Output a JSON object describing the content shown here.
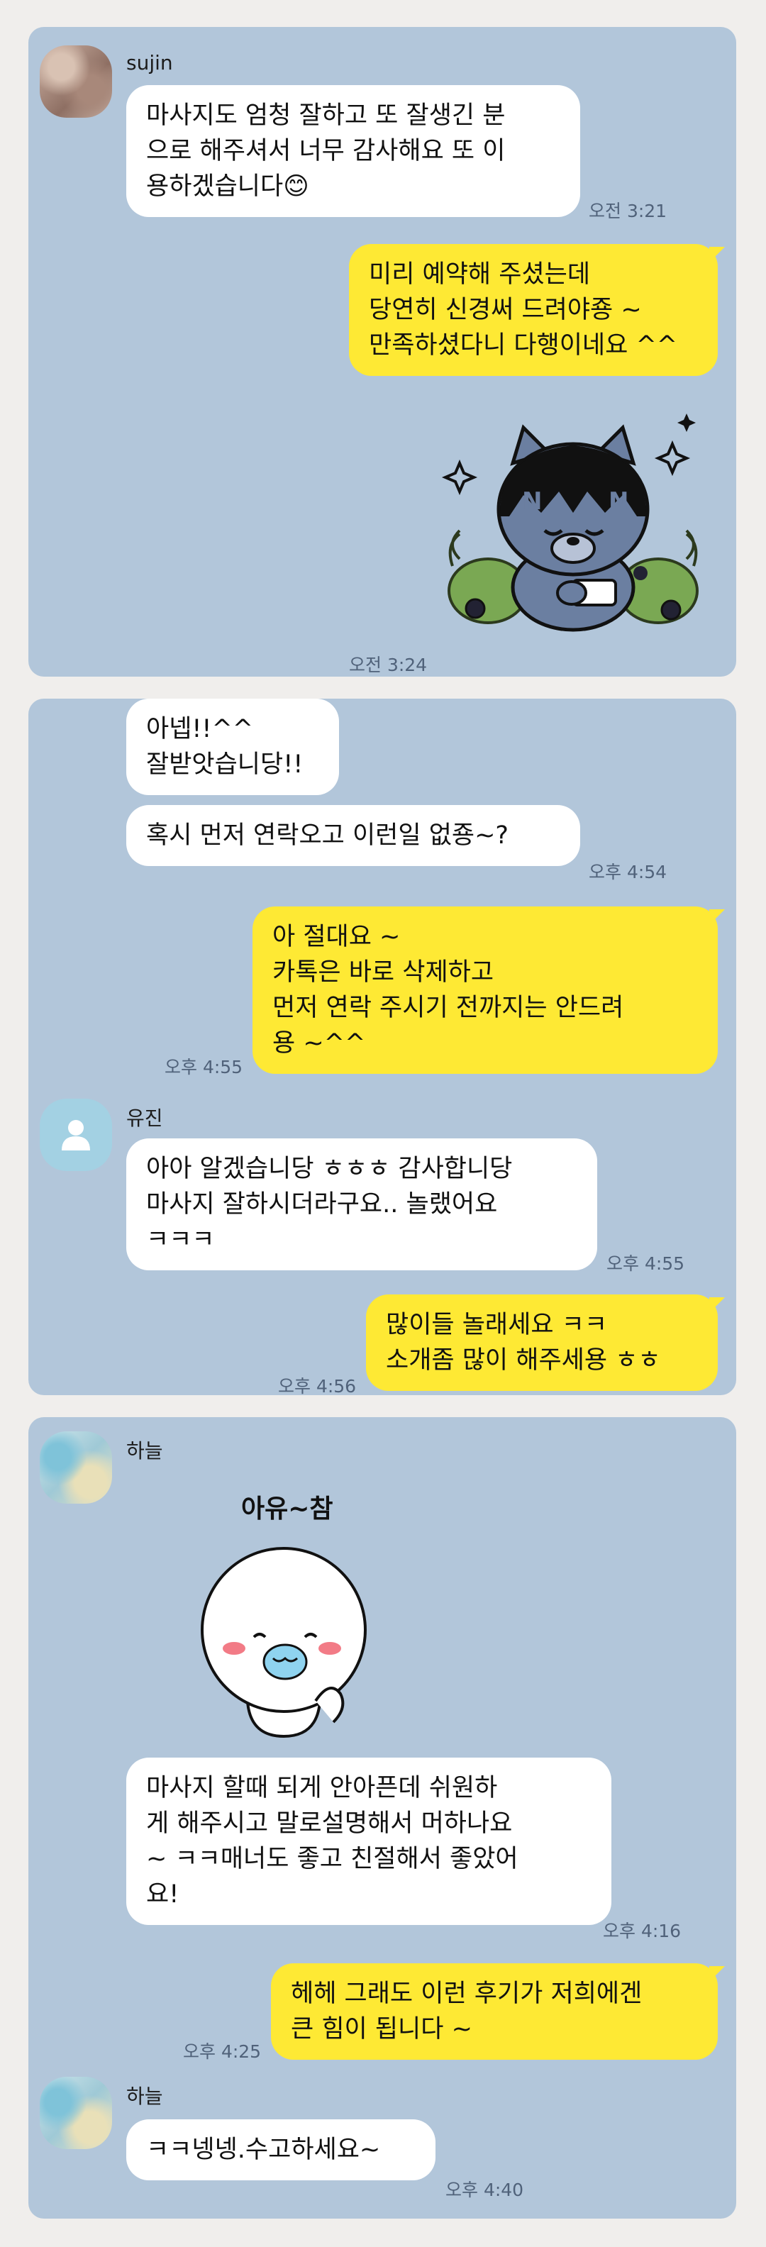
{
  "screenshots": [
    {
      "messages": {
        "m1": {
          "sender": "sujin",
          "text": "마사지도 엄청 잘하고 또 잘생긴 분\n으로 해주셔서 너무 감사해요 또 이\n용하겠습니다😊",
          "time": "오전 3:21"
        },
        "m2": {
          "text": "미리 예약해 주셨는데\n당연히 신경써 드려야죵 ~\n만족하셨다니 다행이네요 ^^"
        },
        "m3": {
          "sticker": "cat-sticker",
          "time": "오전 3:24"
        }
      }
    },
    {
      "messages": {
        "m1": {
          "text": "아넵!!^^\n잘받앗습니당!!"
        },
        "m2": {
          "text": "혹시 먼저 연락오고 이런일 없죵~?",
          "time": "오후 4:54"
        },
        "m3": {
          "text": "아 절대요 ~\n카톡은 바로 삭제하고\n먼저 연락 주시기 전까지는 안드려\n용 ~^^",
          "time": "오후 4:55"
        },
        "m4": {
          "sender": "유진",
          "text": "아아 알겠습니당 ㅎㅎㅎ 감사합니당\n마사지 잘하시더라구요.. 놀랬어요\nㅋㅋㅋ",
          "time": "오후 4:55"
        },
        "m5": {
          "text": "많이들 놀래세요 ㅋㅋ\n소개좀 많이 해주세용 ㅎㅎ",
          "time": "오후 4:56"
        }
      }
    },
    {
      "messages": {
        "m1": {
          "sender": "하늘",
          "sticker": "ghost-sticker",
          "sticker_text": "아유~참"
        },
        "m2": {
          "text": "마사지 할때 되게 안아픈데 쉬원하\n게 해주시고 말로설명해서 머하나요\n~ ㅋㅋ매너도 좋고 친절해서 좋았어\n요!",
          "time": "오후 4:16"
        },
        "m3": {
          "text": "헤헤 그래도 이런 후기가 저희에겐\n큰 힘이 됩니다 ~",
          "time": "오후 4:25"
        },
        "m4": {
          "sender": "하늘",
          "text": "ㅋㅋ넹넹.수고하세요~",
          "time": "오후 4:40"
        }
      }
    }
  ],
  "colors": {
    "chat_background": "#b2c6da",
    "page_background": "#f0eeec",
    "my_bubble": "#fee934",
    "their_bubble": "#ffffff",
    "timestamp": "#50627a"
  }
}
